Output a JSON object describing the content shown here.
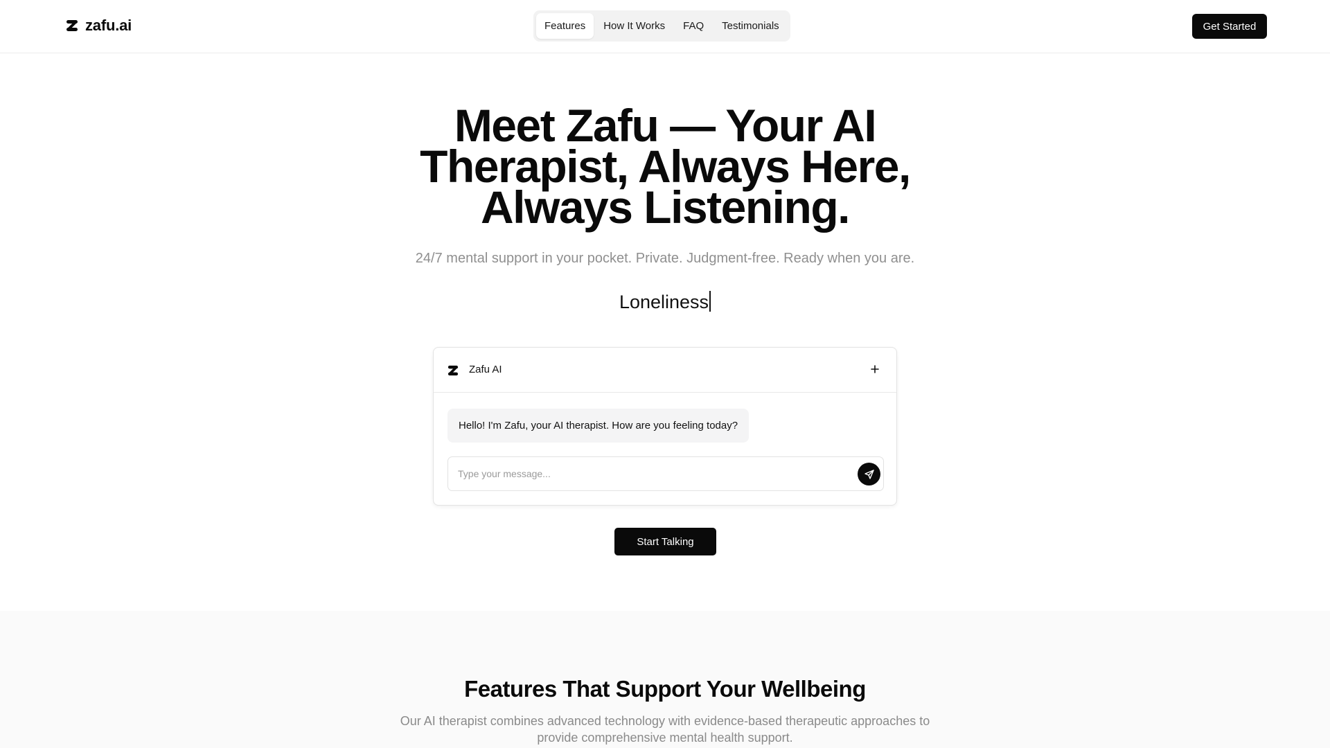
{
  "brand": {
    "name": "zafu.ai",
    "logo_icon": "zafu-logo-icon"
  },
  "nav": {
    "items": [
      {
        "label": "Features",
        "active": true
      },
      {
        "label": "How It Works",
        "active": false
      },
      {
        "label": "FAQ",
        "active": false
      },
      {
        "label": "Testimonials",
        "active": false
      }
    ]
  },
  "header": {
    "cta_label": "Get Started"
  },
  "hero": {
    "title_lines": [
      "Meet Zafu — Your AI",
      "Therapist, Always Here,",
      "Always Listening."
    ],
    "subtitle": "24/7 mental support in your pocket. Private. Judgment-free. Ready when you are.",
    "typing_word": "Loneliness"
  },
  "chat": {
    "title": "Zafu AI",
    "new_chat_icon": "plus-icon",
    "message": "Hello! I'm Zafu, your AI therapist. How are you feeling today?",
    "input_value": "",
    "input_placeholder": "Type your message...",
    "send_icon": "send-icon"
  },
  "start_button_label": "Start Talking",
  "features": {
    "title": "Features That Support Your Wellbeing",
    "subtitle_lines": [
      "Our AI therapist combines advanced technology with evidence-based therapeutic approaches to",
      "provide comprehensive mental health support."
    ]
  },
  "colors": {
    "primary": "#0a0a0a",
    "muted_text": "#8f8f8f",
    "nav_bg": "#f2f2f2",
    "bubble_bg": "#f4f4f5",
    "section_bg": "#fafafa"
  }
}
